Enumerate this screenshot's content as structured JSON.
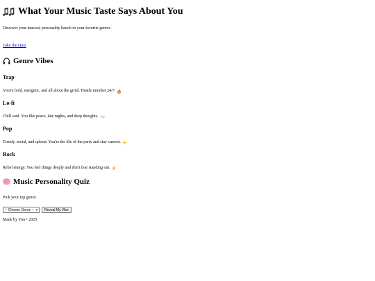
{
  "header": {
    "icon": "musical-notes-icon",
    "title": "What Your Music Taste Says About You",
    "subtitle": "Discover your musical personality based on your favorite genres",
    "cta_link": "Take the Quiz"
  },
  "genres_section": {
    "icon": "headphones-icon",
    "title": "Genre Vibes",
    "items": [
      {
        "name": "Trap",
        "description": "You're bold, energetic, and all about the grind. Hustle mindset 24/7.",
        "icon": "fire-icon"
      },
      {
        "name": "Lo-fi",
        "description": "Chill soul. You like peace, late nights, and deep thoughts.",
        "icon": "cloud-icon"
      },
      {
        "name": "Pop",
        "description": "Trendy, social, and upbeat. You're the life of the party and stay current.",
        "icon": "sparkle-star-icon"
      },
      {
        "name": "Rock",
        "description": "Rebel energy. You feel things deeply and don't fear standing out.",
        "icon": "lightning-icon"
      }
    ]
  },
  "quiz_section": {
    "icon": "brain-icon",
    "title": "Music Personality Quiz",
    "prompt": "Pick your top genre:",
    "select_value": "-- Choose Genre --",
    "button_label": "Reveal My Vibe"
  },
  "footer": {
    "text": "Made by You • 2025"
  },
  "colors": {
    "link": "#0000ee",
    "fire": "#f26522",
    "star": "#f5c518",
    "lightning": "#f5a623",
    "brain": "#e88aa3"
  }
}
